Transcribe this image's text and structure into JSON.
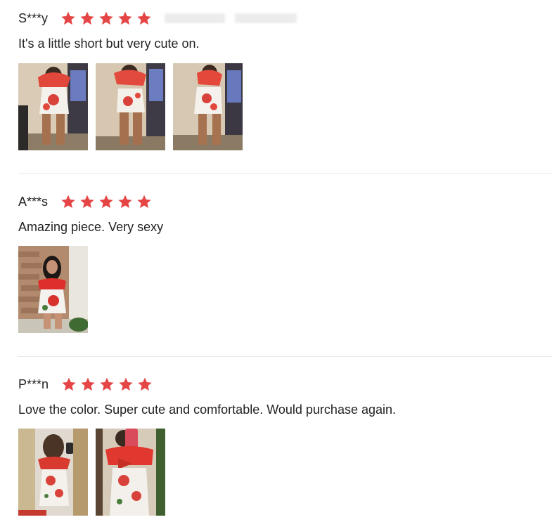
{
  "colors": {
    "star": "#e64545",
    "divider": "#e8e8e8",
    "text": "#222222"
  },
  "reviews": [
    {
      "reviewer": "S***y",
      "rating": 5,
      "text": "It's a little short but very cute on.",
      "photos": [
        "photo-1",
        "photo-2",
        "photo-3"
      ]
    },
    {
      "reviewer": "A***s",
      "rating": 5,
      "text": "Amazing piece. Very sexy",
      "photos": [
        "photo-1"
      ]
    },
    {
      "reviewer": "P***n",
      "rating": 5,
      "text": "Love the color. Super cute and comfortable. Would purchase again.",
      "photos": [
        "photo-1",
        "photo-2"
      ]
    }
  ],
  "icons": {
    "star": "star-icon"
  }
}
